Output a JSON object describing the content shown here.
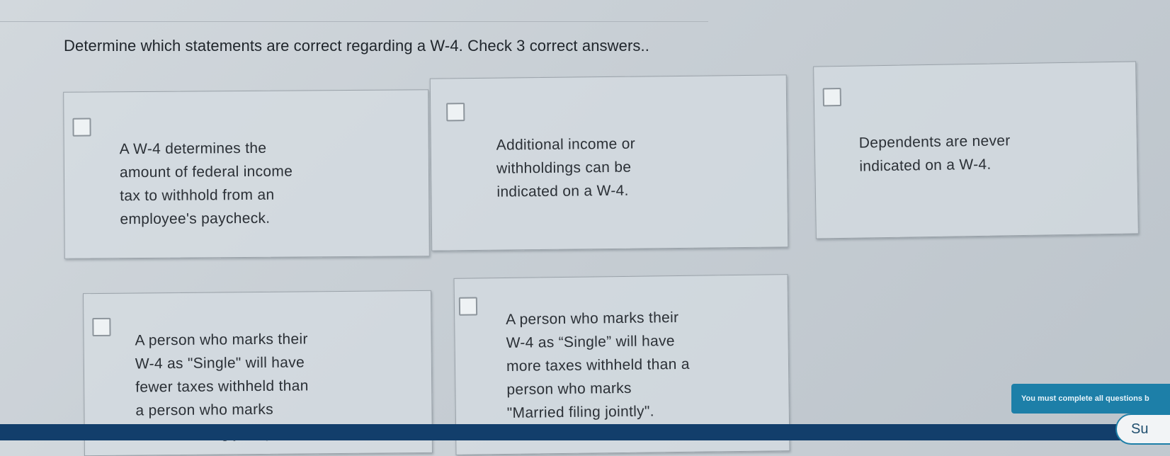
{
  "question": {
    "prompt": "Determine which statements are correct regarding a W-4. Check 3 correct answers.."
  },
  "options": [
    {
      "lines": [
        "A W-4 determines the",
        "amount of federal income",
        "tax to withhold from an",
        "employee's paycheck."
      ]
    },
    {
      "lines": [
        "Additional income or",
        "withholdings can be",
        "indicated on a W-4."
      ]
    },
    {
      "lines": [
        "Dependents are never",
        "indicated on a W-4."
      ]
    },
    {
      "lines": [
        "A person who marks their",
        "W-4 as \"Single\" will have",
        "fewer taxes withheld than",
        "a person who marks",
        "\"Married filing jointly\"."
      ]
    },
    {
      "lines": [
        "A person who marks their",
        "W-4 as “Single” will have",
        "more taxes withheld than a",
        "person who marks",
        "\"Married filing jointly\"."
      ]
    }
  ],
  "footer": {
    "notice": "You must complete all questions b",
    "submit_label": "Su"
  },
  "colors": {
    "accent": "#1d7fa8",
    "bar": "#123e6b"
  }
}
